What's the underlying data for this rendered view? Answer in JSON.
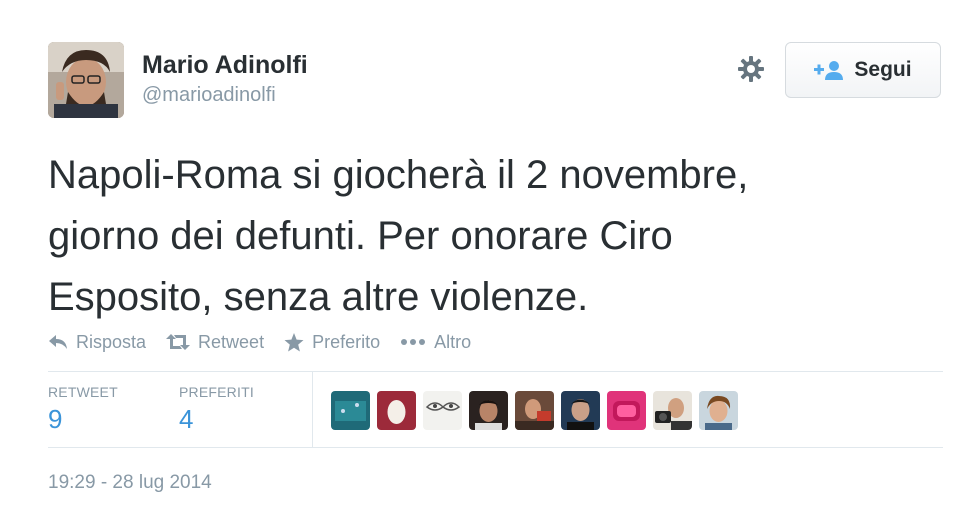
{
  "author": {
    "name": "Mario Adinolfi",
    "handle": "@marioadinolfi"
  },
  "follow_button": {
    "label": "Segui"
  },
  "tweet": {
    "lines": [
      "Napoli-Roma si giocherà il 2 novembre,",
      "giorno dei defunti. Per onorare Ciro",
      "Esposito, senza altre violenze."
    ]
  },
  "actions": {
    "reply": "Risposta",
    "retweet": "Retweet",
    "favorite": "Preferito",
    "more": "Altro"
  },
  "stats": {
    "retweets_label": "RETWEET",
    "retweets_value": "9",
    "favorites_label": "PREFERITI",
    "favorites_value": "4"
  },
  "timestamp": "19:29 - 28 lug 2014",
  "colors": {
    "text": "#292f33",
    "muted": "#8899a6",
    "accent": "#3b94d9",
    "border": "#e1e8ed"
  }
}
